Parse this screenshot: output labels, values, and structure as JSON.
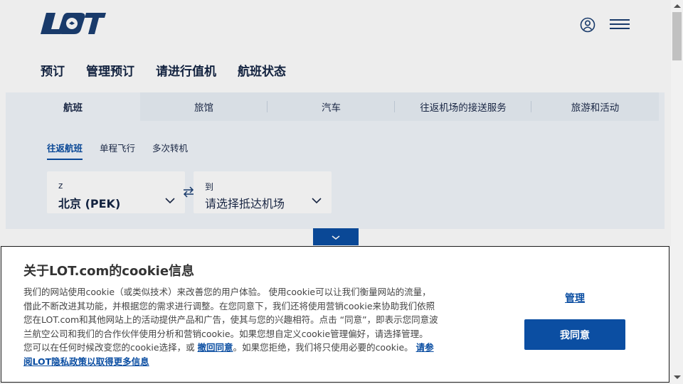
{
  "header": {
    "logo_text": "LOT",
    "nav": [
      "预订",
      "管理预订",
      "请进行值机",
      "航班状态"
    ]
  },
  "booking": {
    "tabs": [
      "航班",
      "旅馆",
      "汽车",
      "往返机场的接送服务",
      "旅游和活动"
    ],
    "subtabs": [
      "往返航班",
      "单程飞行",
      "多次转机"
    ],
    "from": {
      "label": "z",
      "value": "北京 (PEK)"
    },
    "to": {
      "label": "到",
      "placeholder": "请选择抵达机场"
    }
  },
  "cookie": {
    "title": "关于LOT.com的cookie信息",
    "text_part1": "我们的网站使用cookie（或类似技术）来改善您的用户体验。 使用cookie可以让我们衡量网站的流量，借此不断改进其功能，并根据您的需求进行调整。在您同意下，我们还将使用营销cookie来协助我们依照您在LOT.com和其他网站上的活动提供产品和广告，使其与您的兴趣相符。点击 “同意”，即表示您同意波兰航空公司和我们的合作伙伴使用分析和营销cookie。如果您想自定义cookie管理偏好，请选择管理。 您可以在任何时候改变您的cookie选择，或 ",
    "withdraw_link": "撤回同意",
    "text_part2": "。如果您拒绝，我们将只使用必要的cookie。 ",
    "policy_link": "请参阅LOT隐私政策以取得更多信息",
    "manage_label": "管理",
    "agree_label": "我同意"
  },
  "colors": {
    "brand": "#0b4ea2",
    "navy": "#1b3f73"
  }
}
